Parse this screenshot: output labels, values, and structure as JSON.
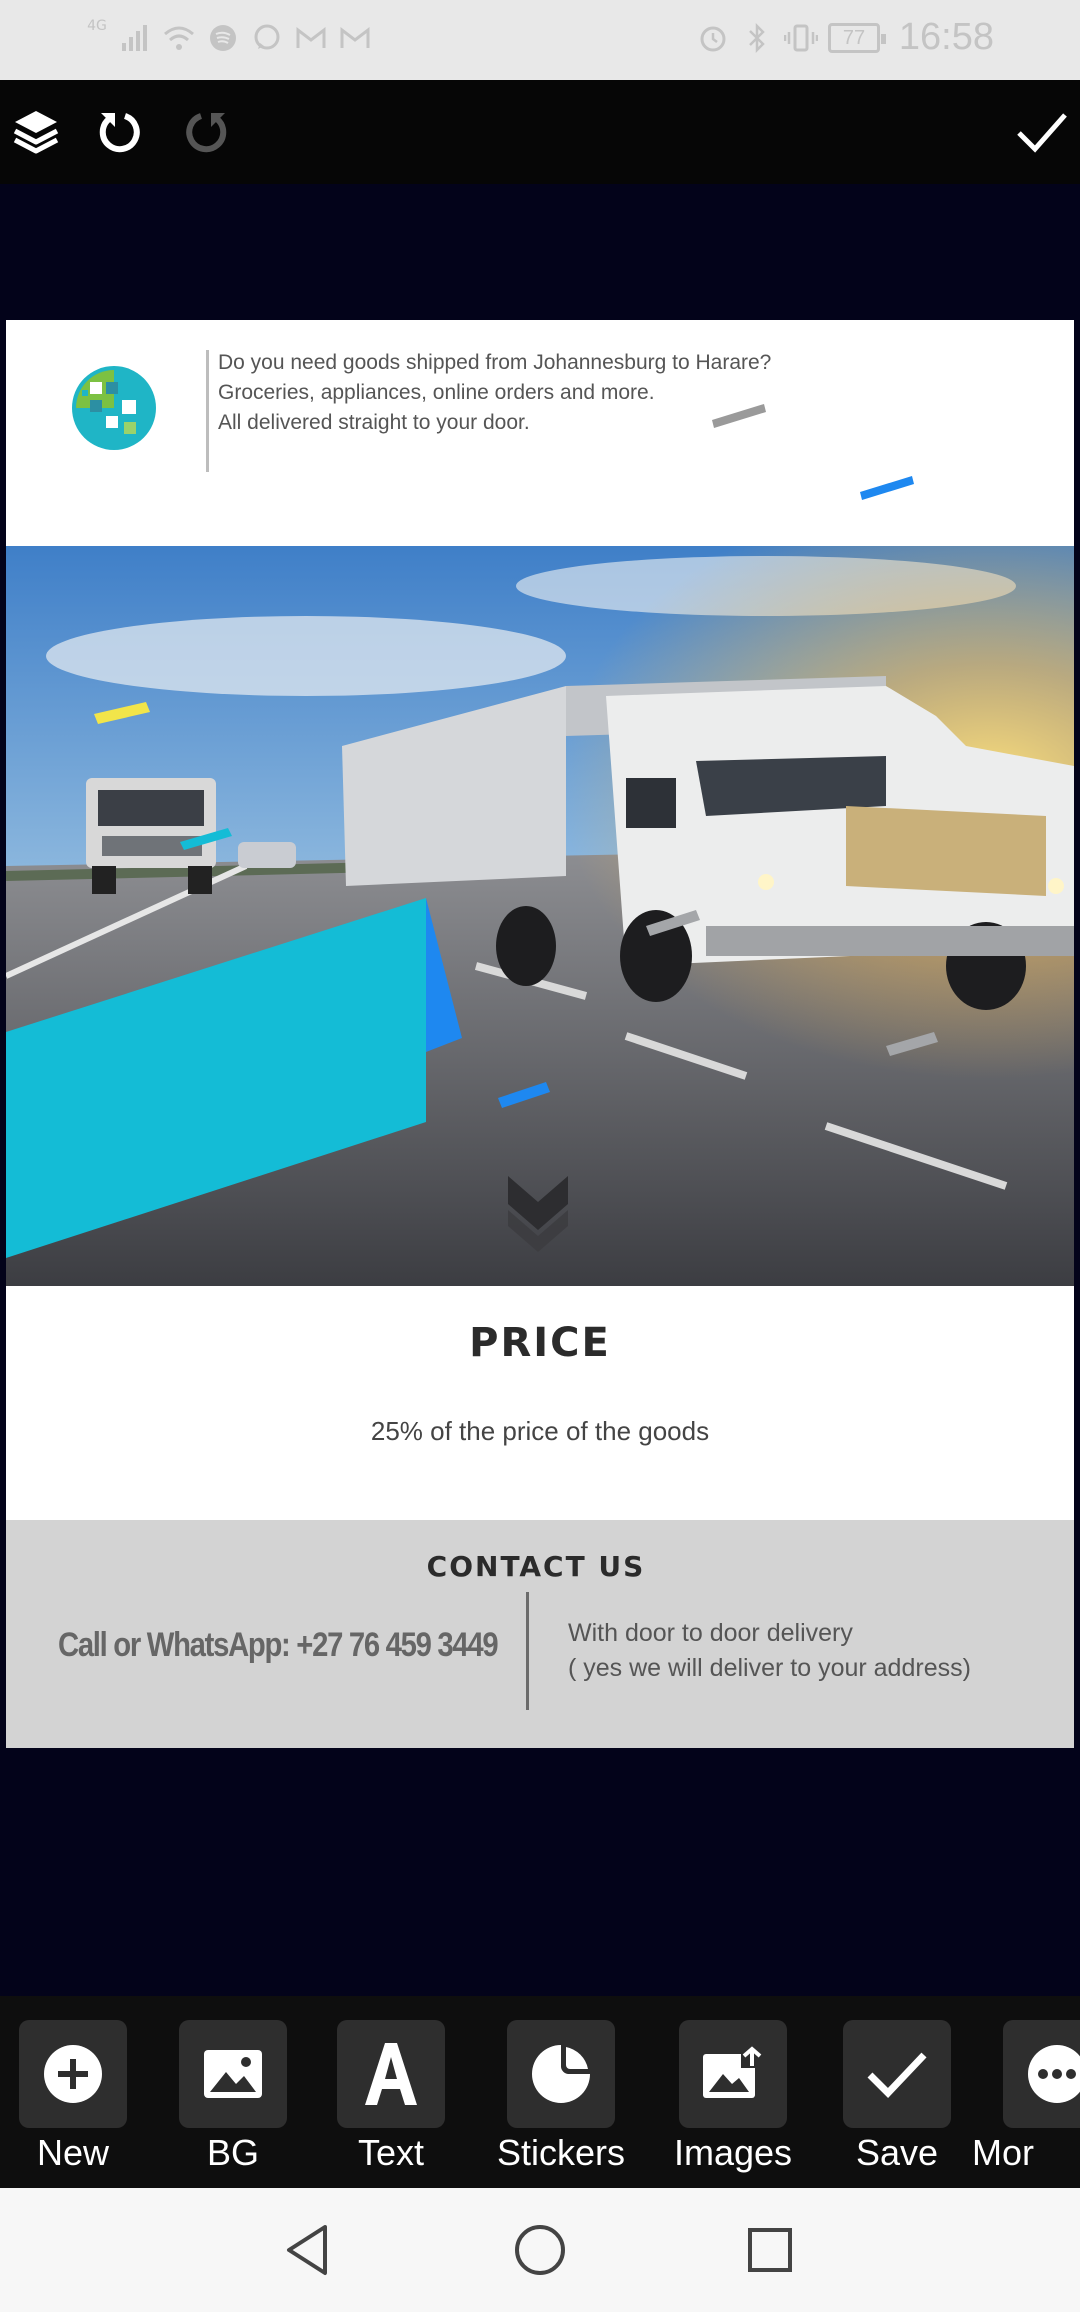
{
  "status_bar": {
    "time": "16:58",
    "battery": "77",
    "network": "4G"
  },
  "toolbar": {
    "icons": [
      "layers-icon",
      "undo-icon",
      "redo-icon",
      "check-icon"
    ]
  },
  "design": {
    "header_lines": [
      "Do you need goods shipped from Johannesburg to Harare?",
      "Groceries, appliances, online orders and more.",
      "All delivered straight to your door."
    ],
    "price_title": "PRICE",
    "price_desc": "25% of the price of the goods",
    "contact_title": "CONTACT US",
    "contact_phone": "Call or WhatsApp: +27 76 459 3449",
    "contact_note_lines": [
      "With door to door delivery",
      "( yes we will deliver to your address)"
    ],
    "colors": {
      "accent_cyan": "#14bcd6",
      "accent_blue": "#1e88f0",
      "accent_yellow": "#f2e54a"
    }
  },
  "editor_tools": [
    {
      "label": "New",
      "icon": "plus-circle-icon"
    },
    {
      "label": "BG",
      "icon": "image-icon"
    },
    {
      "label": "Text",
      "icon": "text-a-icon"
    },
    {
      "label": "Stickers",
      "icon": "sticker-icon"
    },
    {
      "label": "Images",
      "icon": "add-image-icon"
    },
    {
      "label": "Save",
      "icon": "check-icon"
    },
    {
      "label": "Mor",
      "icon": "more-icon"
    }
  ],
  "nav_bar": {
    "icons": [
      "back-icon",
      "home-icon",
      "recents-icon"
    ]
  }
}
